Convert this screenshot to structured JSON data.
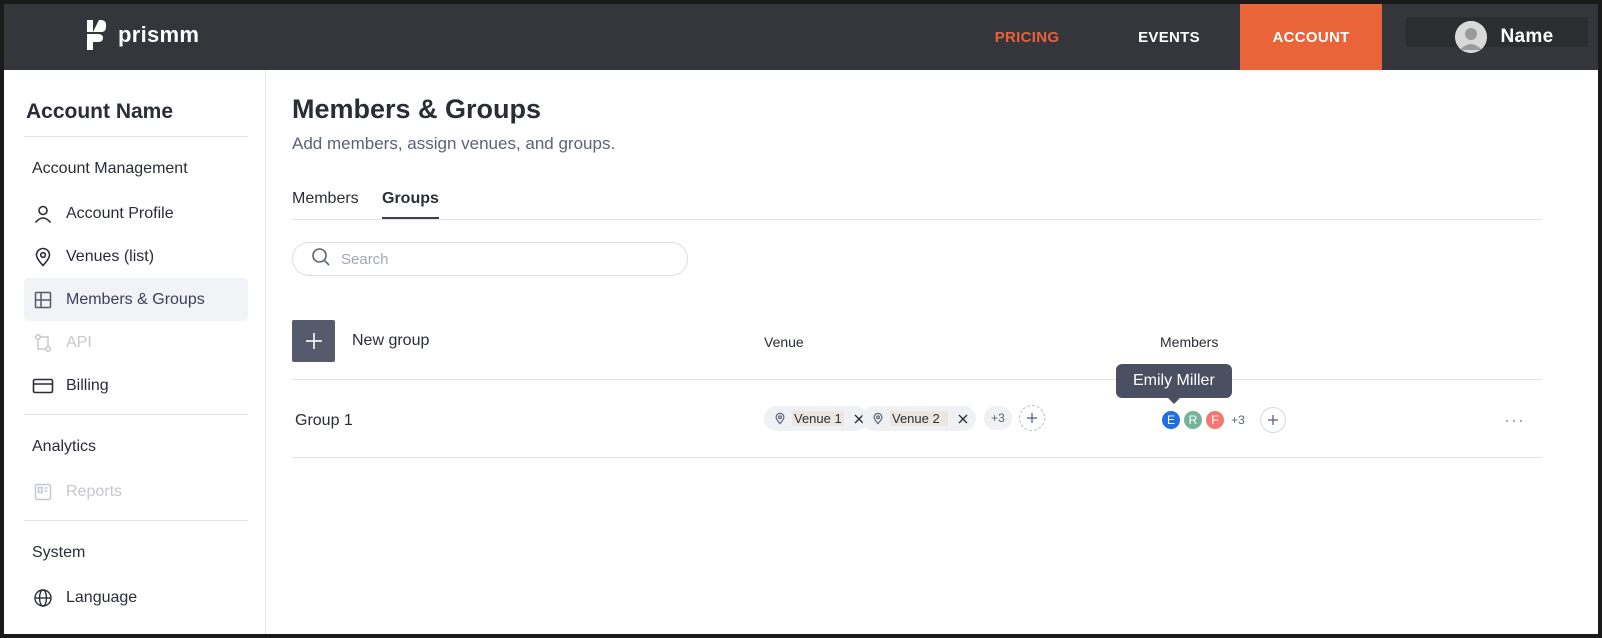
{
  "topbar": {
    "logo_text": "prismm",
    "nav": {
      "pricing": "PRICING",
      "events": "EVENTS",
      "account": "ACCOUNT"
    },
    "user_name": "Name",
    "colors": {
      "bar": "#34363c",
      "accent": "#ea6439"
    }
  },
  "sidebar": {
    "account_name": "Account Name",
    "sections": {
      "management": "Account Management",
      "analytics": "Analytics",
      "system": "System"
    },
    "items": {
      "profile": {
        "label": "Account Profile",
        "icon": "user-icon"
      },
      "venues": {
        "label": "Venues (list)",
        "icon": "location-pin-icon"
      },
      "members": {
        "label": "Members & Groups",
        "icon": "grid-icon"
      },
      "api": {
        "label": "API",
        "icon": "api-icon"
      },
      "billing": {
        "label": "Billing",
        "icon": "credit-card-icon"
      },
      "reports": {
        "label": "Reports",
        "icon": "reports-icon"
      },
      "language": {
        "label": "Language",
        "icon": "globe-icon"
      }
    }
  },
  "main": {
    "title": "Members & Groups",
    "subtitle": "Add members, assign venues, and groups.",
    "tabs": {
      "members": "Members",
      "groups": "Groups"
    },
    "search": {
      "placeholder": "Search"
    },
    "table": {
      "new_group_label": "New group",
      "columns": {
        "venue": "Venue",
        "members": "Members"
      },
      "row": {
        "name": "Group 1",
        "venues": [
          "Venue 1",
          "Venue 2"
        ],
        "venue_more": "+3",
        "member_initials": [
          "E",
          "R",
          "F"
        ],
        "member_colors": [
          "#1f6fe0",
          "#74b59a",
          "#f07a72"
        ],
        "member_more": "+3",
        "more": "···"
      }
    },
    "tooltip": "Emily Miller"
  }
}
